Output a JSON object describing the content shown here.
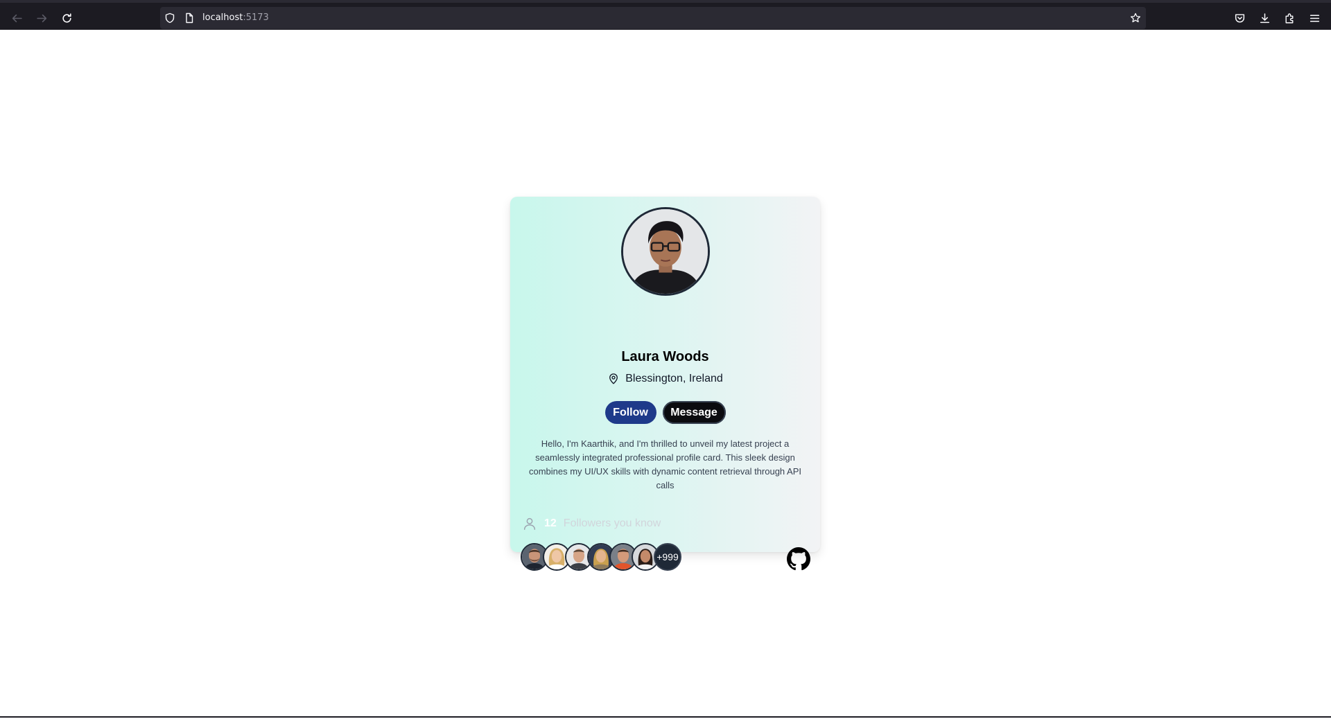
{
  "browser": {
    "url_host": "localhost",
    "url_port": ":5173"
  },
  "profile": {
    "name": "Laura Woods",
    "location": "Blessington, Ireland",
    "follow_label": "Follow",
    "message_label": "Message",
    "bio": "Hello, I'm Kaarthik, and I'm thrilled to unveil my latest project a seamlessly integrated professional profile card. This sleek design combines my UI/UX skills with dynamic content retrieval through API calls"
  },
  "followers": {
    "count": "12",
    "label": "Followers you know",
    "more_label": "+999",
    "avatars": [
      "follower-1",
      "follower-2",
      "follower-3",
      "follower-4",
      "follower-5",
      "follower-6"
    ]
  },
  "colors": {
    "follow_button": "#1e3a8a",
    "message_button": "#0b0b0f",
    "card_gradient_start": "#c8f7ec",
    "card_gradient_end": "#f2f3f5"
  }
}
